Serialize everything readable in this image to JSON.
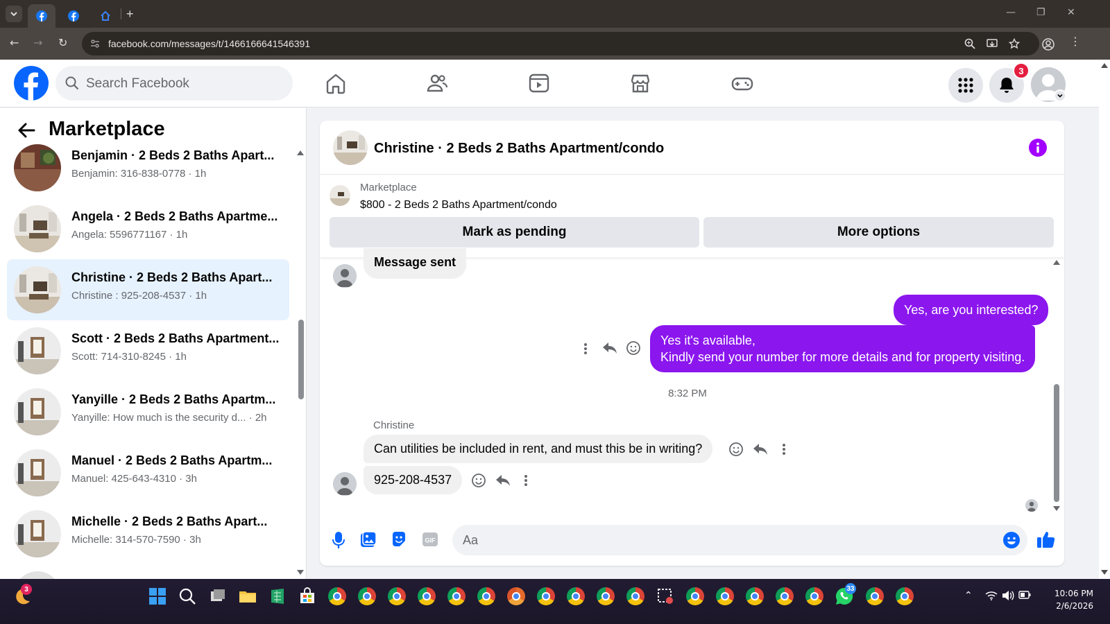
{
  "browser": {
    "url": "facebook.com/messages/t/1466166641546391"
  },
  "header": {
    "search_placeholder": "Search Facebook",
    "notification_count": "3"
  },
  "sidebar": {
    "title": "Marketplace",
    "conversations": [
      {
        "name": "Benjamin · 2 Beds 2 Baths Apart...",
        "preview": "Benjamin: 316-838-0778 · 1h",
        "selected": false
      },
      {
        "name": "Angela · 2 Beds 2 Baths Apartme...",
        "preview": "Angela: 5596771167 · 1h",
        "selected": false
      },
      {
        "name": "Christine · 2 Beds 2 Baths Apart...",
        "preview": "Christine : 925-208-4537 · 1h",
        "selected": true
      },
      {
        "name": "Scott · 2 Beds 2 Baths Apartment...",
        "preview": "Scott: 714-310-8245 · 1h",
        "selected": false
      },
      {
        "name": "Yanyille · 2 Beds 2 Baths Apartm...",
        "preview": "Yanyille: How much is the security d... · 2h",
        "selected": false
      },
      {
        "name": "Manuel · 2 Beds 2 Baths Apartm...",
        "preview": "Manuel: 425-643-4310 · 3h",
        "selected": false
      },
      {
        "name": "Michelle · 2 Beds 2 Baths Apart...",
        "preview": "Michelle: 314-570-7590 · 3h",
        "selected": false
      }
    ]
  },
  "chat": {
    "title": "Christine · 2 Beds 2 Baths Apartment/condo",
    "listing_label": "Marketplace",
    "listing_price_title": "$800 - 2 Beds 2 Baths Apartment/condo",
    "mark_pending_label": "Mark as pending",
    "more_options_label": "More options",
    "messages": {
      "m1": "Message sent",
      "m2": "Yes, are you interested?",
      "m3_line1": "Yes it's available,",
      "m3_line2": "Kindly send your number for more details and for property visiting.",
      "time": "8:32 PM",
      "sender": "Christine",
      "m4": "Can utilities be included in rent, and must this be in writing?",
      "m5": "925-208-4537"
    },
    "composer_placeholder": "Aa"
  },
  "taskbar": {
    "weather_badge": "3",
    "chrome_badge": "",
    "whatsapp_badge": "33",
    "time": "10:06 PM",
    "date": "2/6/2026"
  },
  "colors": {
    "fb_blue": "#0866ff",
    "outgoing_bubble": "#8b16ee",
    "selected_row": "#e6f2fe"
  }
}
